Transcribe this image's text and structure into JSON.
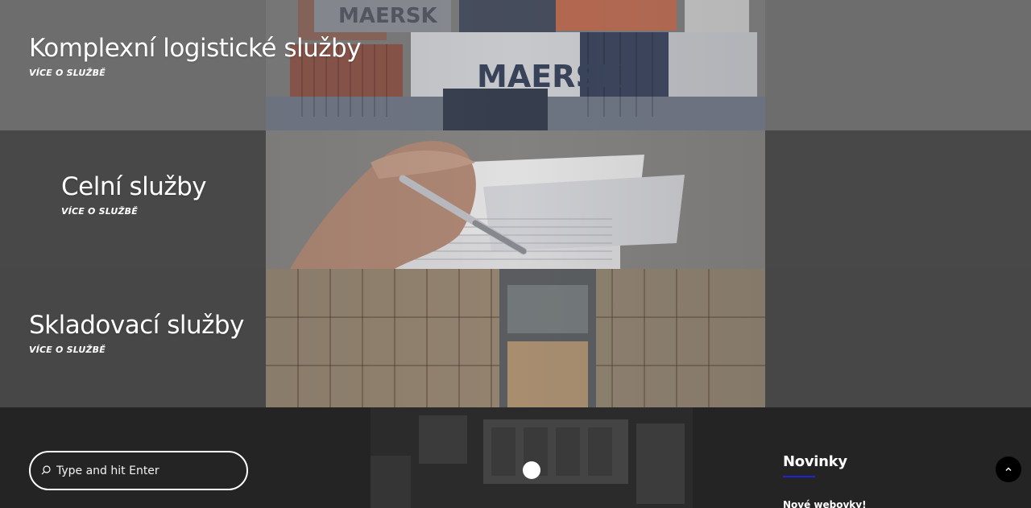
{
  "services": [
    {
      "title": "Komplexní logistické služby",
      "link": "VÍCE O SLUŽBĚ",
      "image": "shipping-containers"
    },
    {
      "title": "Celní služby",
      "link": "VÍCE O SLUŽBĚ",
      "image": "pen-on-documents"
    },
    {
      "title": "Skladovací služby",
      "link": "VÍCE O SLUŽBĚ",
      "image": "warehouse-crates"
    }
  ],
  "footer": {
    "search": {
      "placeholder": "Type and hit Enter",
      "value": "",
      "icon": "search-icon"
    },
    "news": {
      "heading": "Novinky",
      "items": [
        "Nové webovky!"
      ],
      "accent_color": "#1f24d8"
    },
    "back_to_top_icon": "chevron-up-icon"
  },
  "colors": {
    "band1": "#6d6d6d",
    "band2": "#484848",
    "band3": "#474747",
    "footer": "#242424"
  }
}
